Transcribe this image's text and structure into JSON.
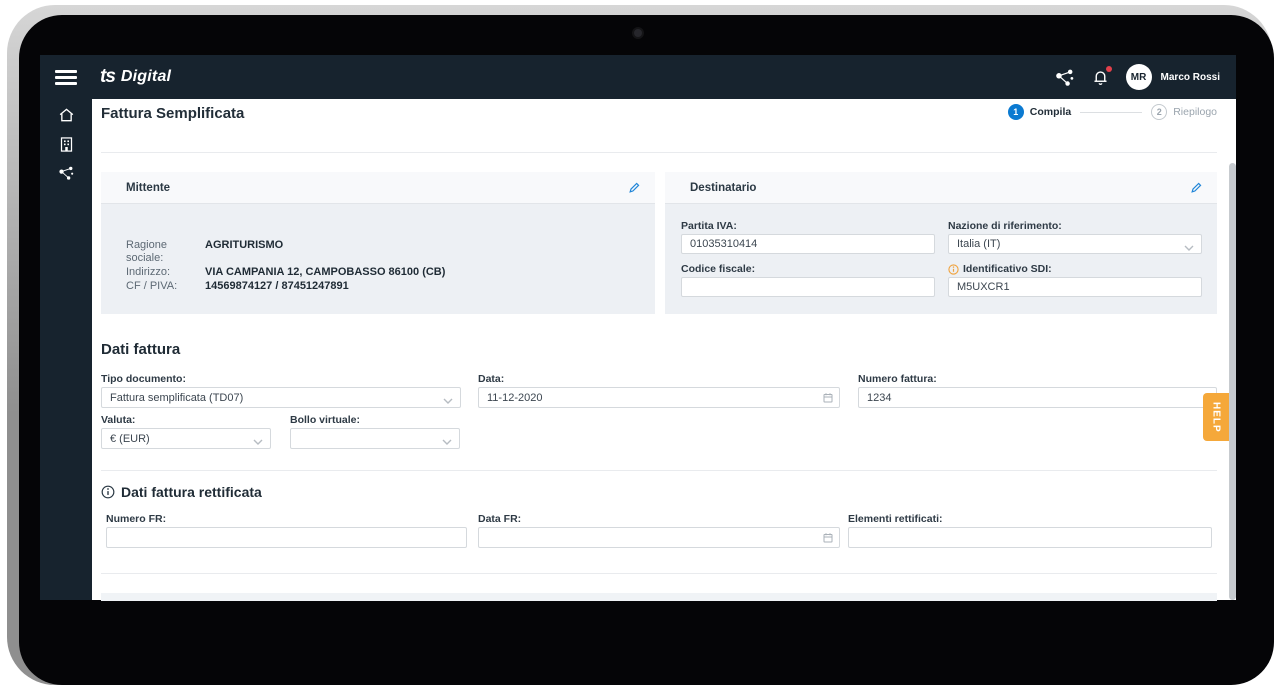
{
  "colors": {
    "navy": "#17232e",
    "accent_blue": "#0b7ad1",
    "help_orange": "#f5a83a",
    "notification_red": "#e3404b",
    "card_body_gray": "#edf0f4"
  },
  "topbar": {
    "logo_mark": "ts",
    "logo_text": "Digital",
    "user_initials": "MR",
    "user_name": "Marco Rossi"
  },
  "page": {
    "title": "Fattura Semplificata",
    "steps": [
      {
        "num": "1",
        "label": "Compila",
        "state": "active"
      },
      {
        "num": "2",
        "label": "Riepilogo",
        "state": "inactive"
      }
    ]
  },
  "mittente": {
    "title": "Mittente",
    "rows": [
      {
        "label": "Ragione sociale:",
        "value": "AGRITURISMO"
      },
      {
        "label": "Indirizzo:",
        "value": "VIA CAMPANIA 12, CAMPOBASSO 86100 (CB)"
      },
      {
        "label": "CF / PIVA:",
        "value": "14569874127 / 87451247891"
      }
    ]
  },
  "destinatario": {
    "title": "Destinatario",
    "partita_iva_label": "Partita IVA:",
    "partita_iva_value": "01035310414",
    "nazione_label": "Nazione di riferimento:",
    "nazione_value": "Italia (IT)",
    "codice_fiscale_label": "Codice fiscale:",
    "codice_fiscale_value": "",
    "sdi_label": "Identificativo SDI:",
    "sdi_value": "M5UXCR1"
  },
  "dati_fattura": {
    "title": "Dati fattura",
    "tipo_label": "Tipo documento:",
    "tipo_value": "Fattura semplificata (TD07)",
    "data_label": "Data:",
    "data_value": "11-12-2020",
    "numero_label": "Numero fattura:",
    "numero_value": "1234",
    "valuta_label": "Valuta:",
    "valuta_value": "€ (EUR)",
    "bollo_label": "Bollo virtuale:",
    "bollo_value": ""
  },
  "dati_rettificata": {
    "title": "Dati fattura rettificata",
    "numero_fr_label": "Numero FR:",
    "numero_fr_value": "",
    "data_fr_label": "Data FR:",
    "data_fr_value": "",
    "elementi_label": "Elementi rettificati:",
    "elementi_value": ""
  },
  "help_tab": {
    "label": "HELP"
  }
}
